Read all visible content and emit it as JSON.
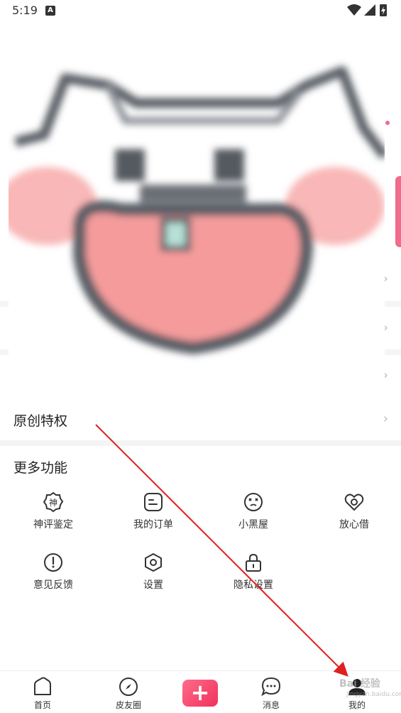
{
  "status_bar": {
    "time": "5:19",
    "notification_badge": "A",
    "icons": [
      "wifi-icon",
      "signal-icon",
      "battery-charging-icon"
    ]
  },
  "sticker": {
    "colors": {
      "outline": "#5a5e66",
      "cheek": "#f7a5a5",
      "mouth": "#f59b9b",
      "tooth": "#b7e0d6"
    }
  },
  "original_privilege": {
    "label": "原创特权"
  },
  "more_functions": {
    "title": "更多功能",
    "items": [
      {
        "label": "神评鉴定",
        "icon": "shen-badge-icon"
      },
      {
        "label": "我的订单",
        "icon": "order-icon"
      },
      {
        "label": "小黑屋",
        "icon": "dizzy-face-icon"
      },
      {
        "label": "放心借",
        "icon": "heart-loan-icon"
      },
      {
        "label": "意见反馈",
        "icon": "exclamation-circle-icon"
      },
      {
        "label": "设置",
        "icon": "settings-hexagon-icon"
      },
      {
        "label": "隐私设置",
        "icon": "lock-icon"
      }
    ]
  },
  "tabbar": {
    "tabs": [
      {
        "label": "首页",
        "icon": "home-icon"
      },
      {
        "label": "皮友圈",
        "icon": "compass-icon"
      },
      {
        "label": "+",
        "icon": "plus-icon"
      },
      {
        "label": "消息",
        "icon": "chat-bubble-icon"
      },
      {
        "label": "我的",
        "icon": "profile-icon"
      }
    ]
  },
  "watermark": {
    "text": "Bai 经验",
    "sub": "jingyan.baidu.com"
  },
  "colors": {
    "accent": "#f0305e",
    "annotation_arrow": "#e02020"
  }
}
